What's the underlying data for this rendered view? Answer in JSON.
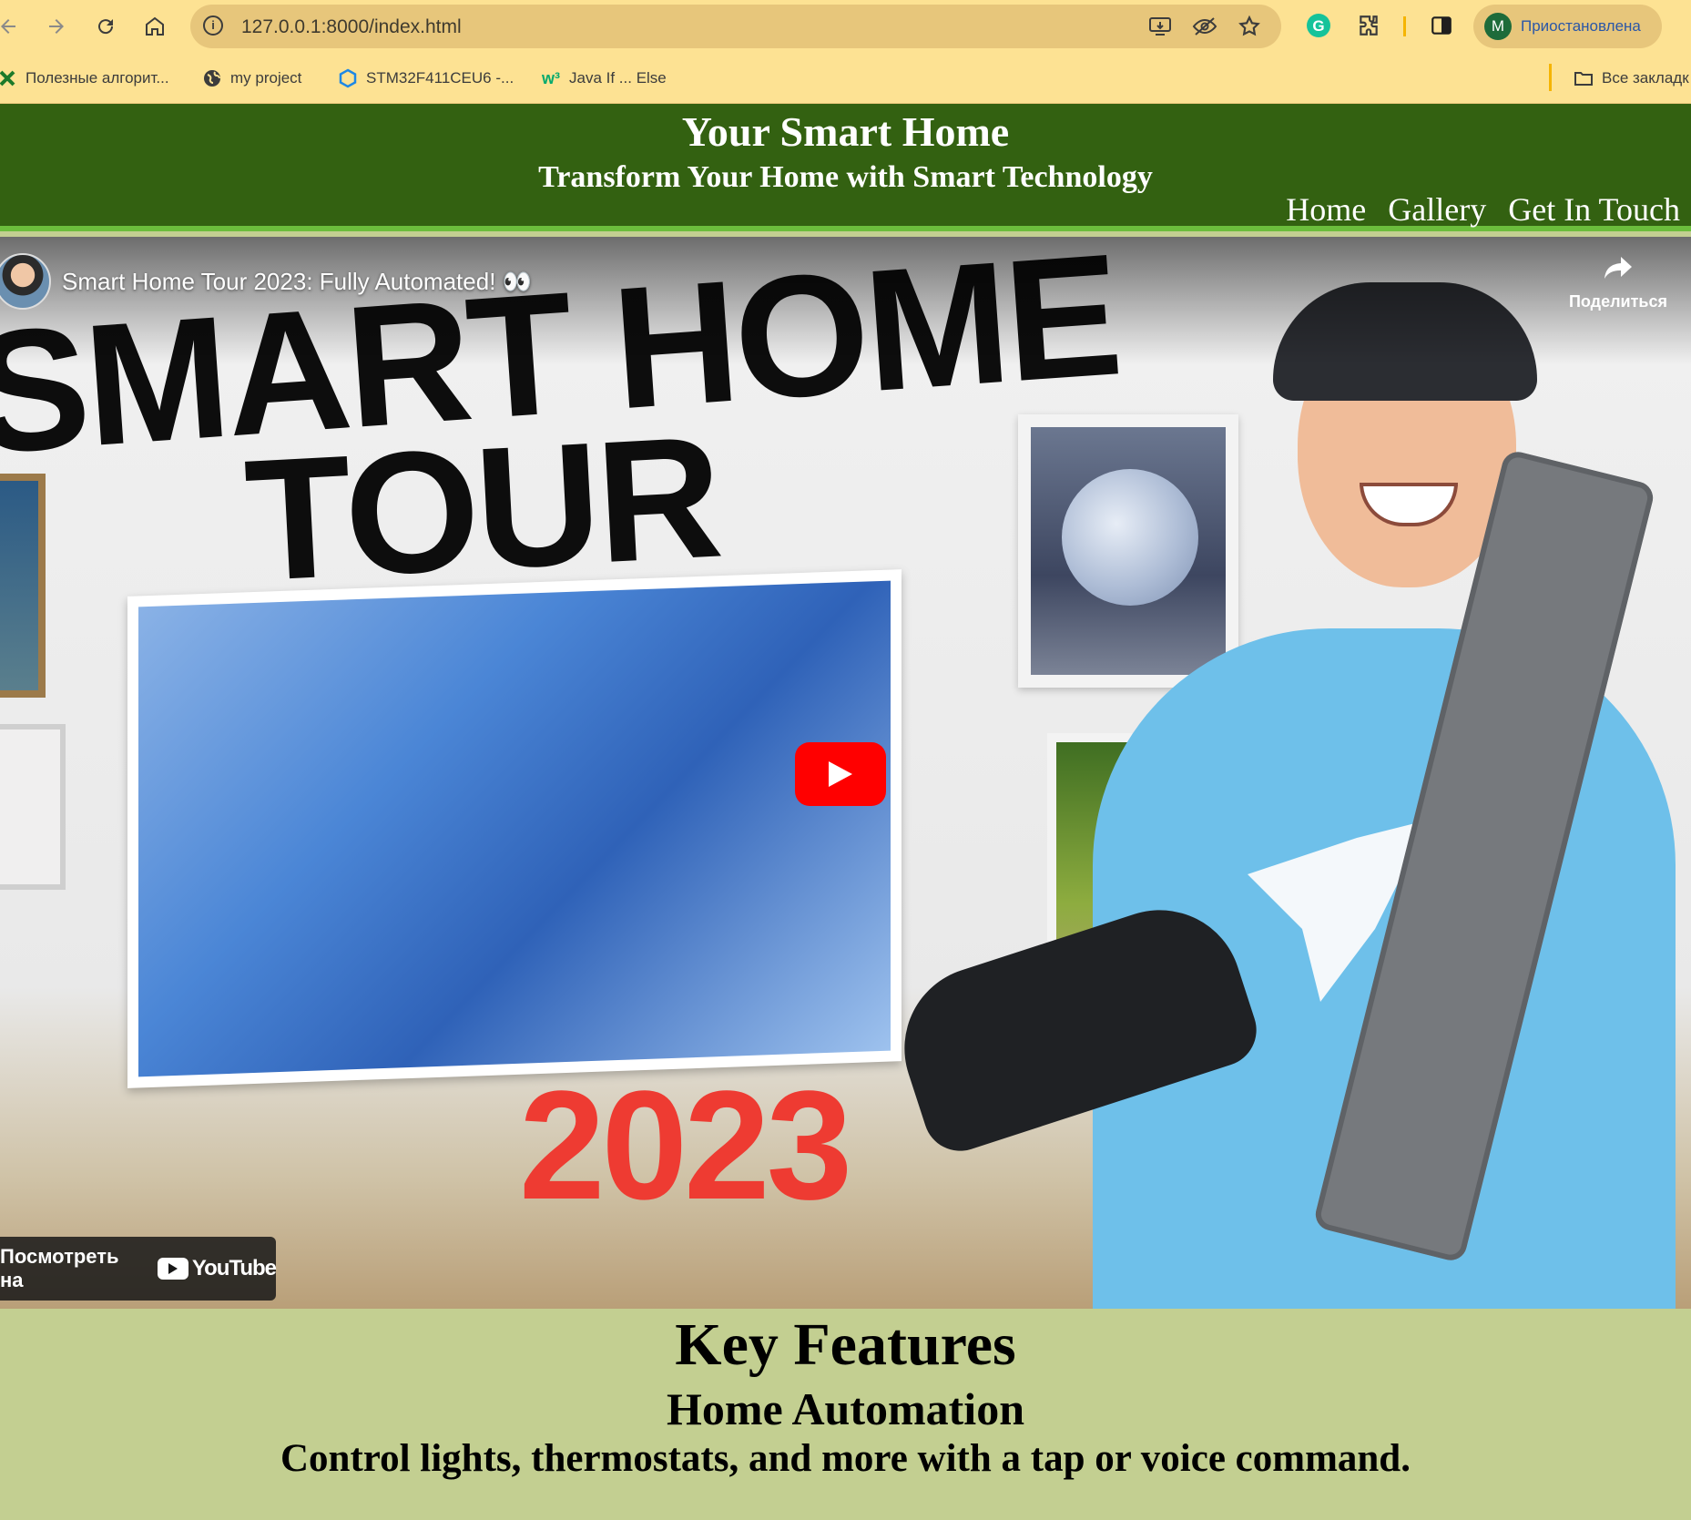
{
  "browser": {
    "url": "127.0.0.1:8000/index.html",
    "profile": {
      "initial": "M",
      "status": "Приостановлена"
    },
    "bookmarks": [
      {
        "label": "Полезные алгорит...",
        "icon": "green-x-icon"
      },
      {
        "label": "my project",
        "icon": "globe-icon"
      },
      {
        "label": "STM32F411CEU6 -...",
        "icon": "hexagon-icon"
      },
      {
        "label": "Java If ... Else",
        "icon": "w3schools-icon"
      }
    ],
    "all_bookmarks_label": "Все закладк"
  },
  "site": {
    "title": "Your Smart Home",
    "tagline": "Transform Your Home with Smart Technology",
    "nav": [
      "Home",
      "Gallery",
      "Get In Touch"
    ],
    "colors": {
      "header_bg": "#336111",
      "header_border": "#6bbd3c",
      "section_bg": "#c3cf91"
    }
  },
  "video": {
    "title": "Smart Home Tour 2023: Fully Automated! 👀",
    "share_label": "Поделиться",
    "thumbnail_text_line1": "SMART HOME",
    "thumbnail_text_line2": "TOUR",
    "thumbnail_year": "2023",
    "watch_on_label": "Посмотреть на",
    "youtube_label": "YouTube"
  },
  "features": {
    "heading": "Key Features",
    "items": [
      {
        "name": "Home Automation",
        "description": "Control lights, thermostats, and more with a tap or voice command."
      }
    ]
  }
}
